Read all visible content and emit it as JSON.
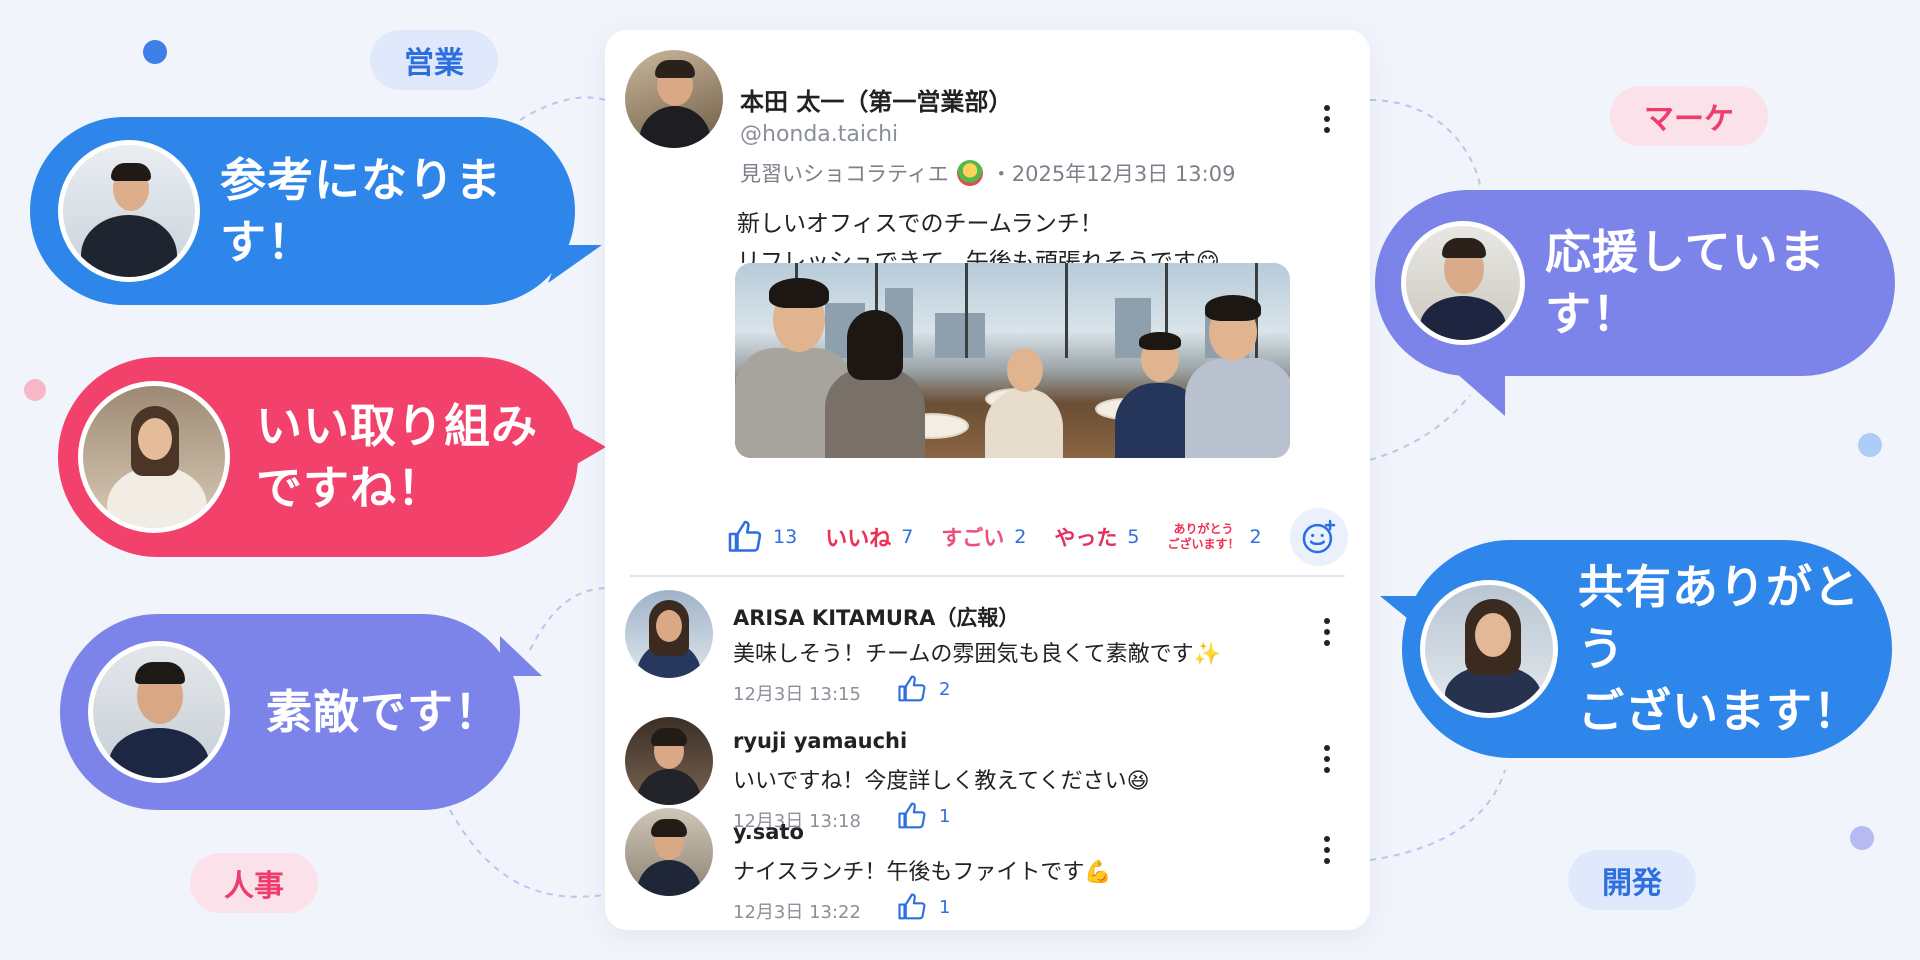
{
  "colors": {
    "background": "#f1f4fb",
    "blue": "#2e86ea",
    "pink": "#f2416b",
    "purple": "#7c84ea",
    "link": "#2e6fe0"
  },
  "tags": {
    "sales": "営業",
    "marketing": "マーケ",
    "hr": "人事",
    "dev": "開発"
  },
  "bubbles": {
    "left1": "参考になります！",
    "left2": "いい取り組み\nですね！",
    "left3": "素敵です！",
    "right1": "応援しています！",
    "right2": "共有ありがとう\nございます！"
  },
  "post": {
    "author": "本田 太一（第一営業部）",
    "handle": "@honda.taichi",
    "rank": "見習いショコラティエ",
    "timestamp": "・2025年12月3日 13:09",
    "body": "新しいオフィスでのチームランチ！\nリフレッシュできて、午後も頑張れそうです😋",
    "reactions": [
      {
        "name": "thumbs-up",
        "label": "",
        "count": "13"
      },
      {
        "name": "iine",
        "label": "いいね",
        "count": "7"
      },
      {
        "name": "sugoi",
        "label": "すごい",
        "count": "2"
      },
      {
        "name": "yatta",
        "label": "やった",
        "count": "5"
      },
      {
        "name": "arigatou",
        "label": "ありがとう\nございます！",
        "count": "2"
      }
    ]
  },
  "comments": [
    {
      "name": "ARISA KITAMURA（広報）",
      "text": "美味しそう！チームの雰囲気も良くて素敵です✨",
      "time": "12月3日 13:15",
      "likes": "2"
    },
    {
      "name": "ryuji yamauchi",
      "text": "いいですね！今度詳しく教えてください😆",
      "time": "12月3日 13:18",
      "likes": "1"
    },
    {
      "name": "y.sato",
      "text": "ナイスランチ！午後もファイトです💪",
      "time": "12月3日 13:22",
      "likes": "1"
    }
  ]
}
